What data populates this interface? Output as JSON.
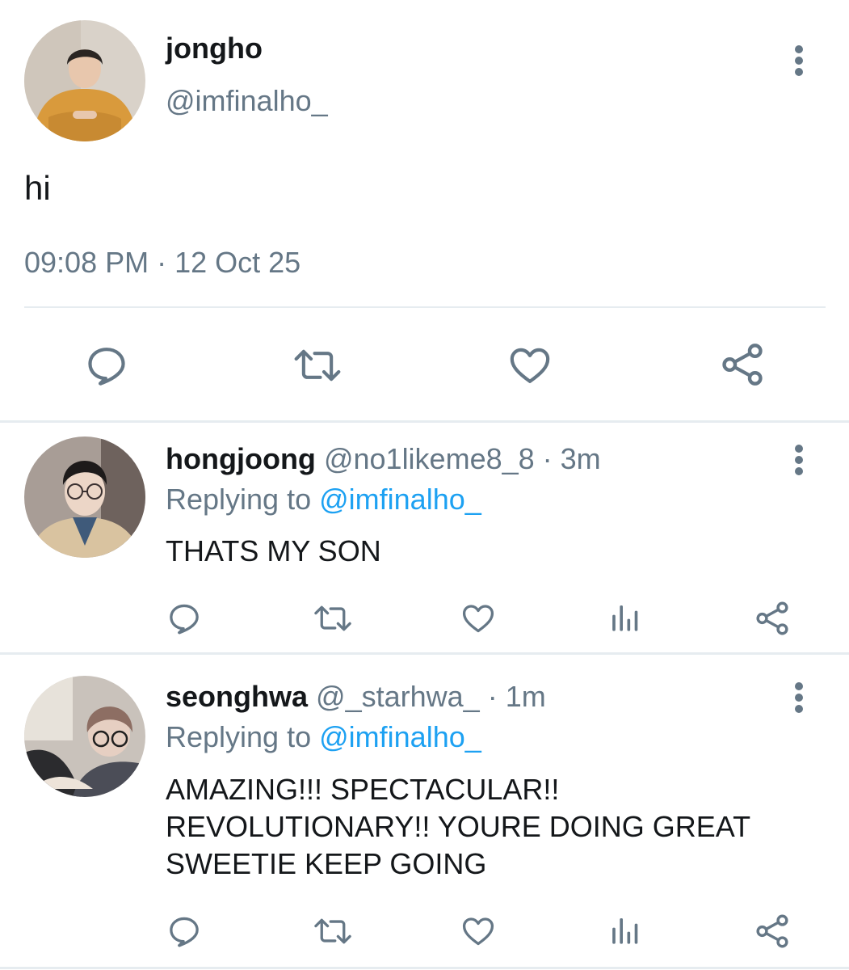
{
  "main_tweet": {
    "name": "jongho",
    "handle": "@imfinalho_",
    "text": "hi",
    "timestamp": "09:08 PM · 12 Oct 25",
    "actions": [
      "reply-icon",
      "retweet-icon",
      "like-icon",
      "share-icon"
    ]
  },
  "replies": [
    {
      "name": "hongjoong",
      "handle": "@no1likeme8_8",
      "time": "· 3m",
      "replying_prefix": "Replying to",
      "replying_to": "@imfinalho_",
      "text_lines": [
        "THATS MY SON"
      ],
      "actions": [
        "reply-icon",
        "retweet-icon",
        "like-icon",
        "analytics-icon",
        "share-icon"
      ]
    },
    {
      "name": "seonghwa",
      "handle": "@_starhwa_",
      "time": "· 1m",
      "replying_prefix": "Replying to",
      "replying_to": "@imfinalho_",
      "text_lines": [
        "AMAZING!!! SPECTACULAR!!",
        "REVOLUTIONARY!! YOURE DOING GREAT",
        "SWEETIE KEEP GOING"
      ],
      "actions": [
        "reply-icon",
        "retweet-icon",
        "like-icon",
        "analytics-icon",
        "share-icon"
      ]
    }
  ],
  "colors": {
    "text_primary": "#14171a",
    "text_secondary": "#657786",
    "link": "#1da1f2",
    "divider": "#e6ecf0"
  }
}
